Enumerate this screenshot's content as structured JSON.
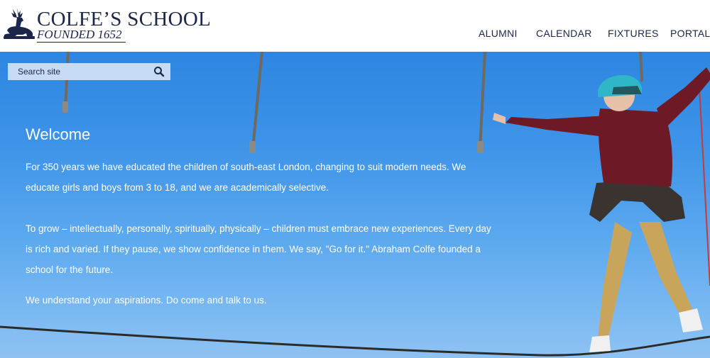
{
  "header": {
    "school_name": "COLFE’S SCHOOL",
    "founded": "FOUNDED 1652",
    "logo_icon": "stag-crest-icon"
  },
  "nav": {
    "items": [
      {
        "label": "ALUMNI"
      },
      {
        "label": "CALENDAR"
      },
      {
        "label": "FIXTURES"
      },
      {
        "label": "PORTALS"
      }
    ]
  },
  "search": {
    "placeholder": "Search site",
    "icon": "search-icon"
  },
  "welcome": {
    "title": "Welcome",
    "paragraphs": [
      "For 350 years we have educated the children of south-east London, changing to suit modern needs. We educate girls and boys from 3 to 18, and we are academically selective.",
      "To grow – intellectually, personally, spiritually, physically – children must embrace new experiences. Every day is rich and varied. If they pause, we show confidence in them. We say, \"Go for it.\" Abraham Colfe founded a school for the future.",
      "We understand your aspirations.  Do come and talk to us."
    ]
  },
  "colors": {
    "brand_navy": "#1b2648",
    "sky": "#3d93e8",
    "search_bg": "#c7dcf4"
  }
}
